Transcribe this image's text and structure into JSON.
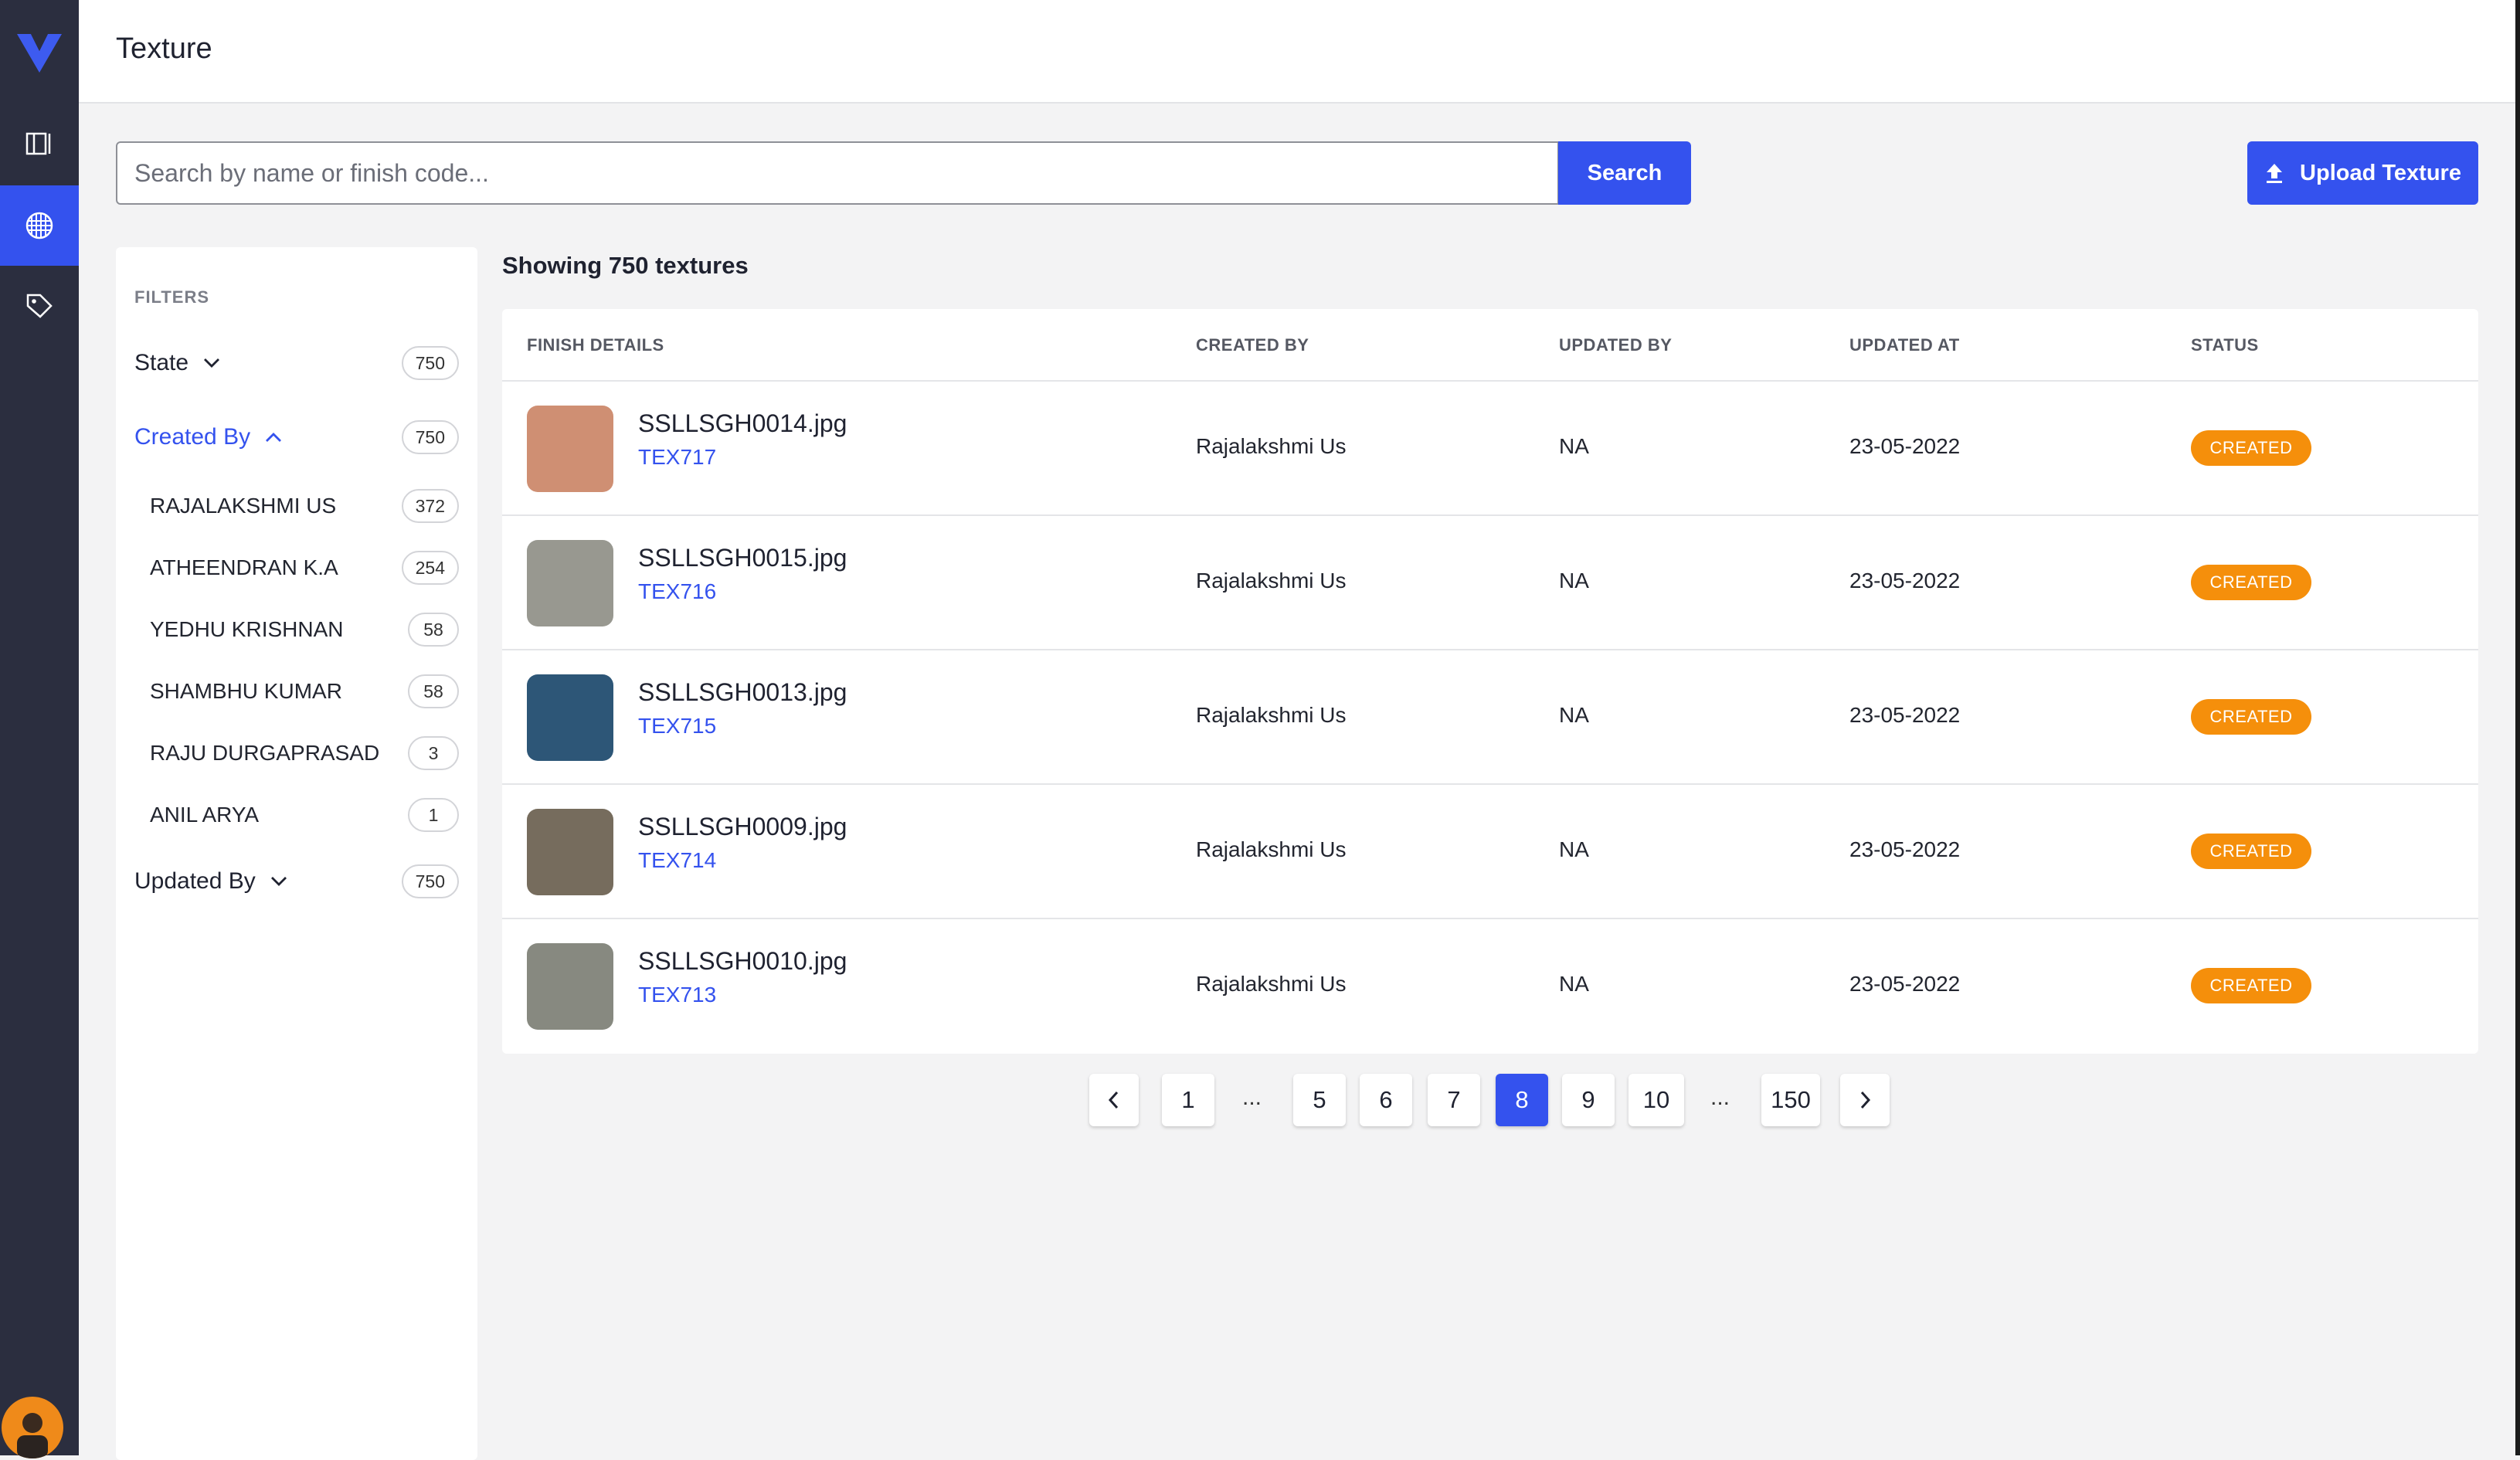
{
  "header": {
    "title": "Texture"
  },
  "search": {
    "placeholder": "Search by name or finish code...",
    "value": "",
    "button_label": "Search"
  },
  "upload": {
    "label": "Upload Texture"
  },
  "filters": {
    "title": "FILTERS",
    "groups": [
      {
        "label": "State",
        "count": "750",
        "expanded": false
      },
      {
        "label": "Created By",
        "count": "750",
        "expanded": true,
        "options": [
          {
            "label": "RAJALAKSHMI US",
            "count": "372"
          },
          {
            "label": "ATHEENDRAN K.A",
            "count": "254"
          },
          {
            "label": "YEDHU KRISHNAN",
            "count": "58"
          },
          {
            "label": "SHAMBHU KUMAR",
            "count": "58"
          },
          {
            "label": "RAJU DURGAPRASAD",
            "count": "3"
          },
          {
            "label": "ANIL ARYA",
            "count": "1"
          }
        ]
      },
      {
        "label": "Updated By",
        "count": "750",
        "expanded": false
      }
    ]
  },
  "list": {
    "showing": "Showing 750 textures",
    "columns": [
      "FINISH DETAILS",
      "CREATED BY",
      "UPDATED BY",
      "UPDATED AT",
      "STATUS"
    ],
    "rows": [
      {
        "file": "SSLLSGH0014.jpg",
        "code": "TEX717",
        "created_by": "Rajalakshmi Us",
        "updated_by": "NA",
        "updated_at": "23-05-2022",
        "status": "CREATED",
        "swatch": "#cf8f73"
      },
      {
        "file": "SSLLSGH0015.jpg",
        "code": "TEX716",
        "created_by": "Rajalakshmi Us",
        "updated_by": "NA",
        "updated_at": "23-05-2022",
        "status": "CREATED",
        "swatch": "#989890"
      },
      {
        "file": "SSLLSGH0013.jpg",
        "code": "TEX715",
        "created_by": "Rajalakshmi Us",
        "updated_by": "NA",
        "updated_at": "23-05-2022",
        "status": "CREATED",
        "swatch": "#2d5677"
      },
      {
        "file": "SSLLSGH0009.jpg",
        "code": "TEX714",
        "created_by": "Rajalakshmi Us",
        "updated_by": "NA",
        "updated_at": "23-05-2022",
        "status": "CREATED",
        "swatch": "#766c5d"
      },
      {
        "file": "SSLLSGH0010.jpg",
        "code": "TEX713",
        "created_by": "Rajalakshmi Us",
        "updated_by": "NA",
        "updated_at": "23-05-2022",
        "status": "CREATED",
        "swatch": "#878980"
      }
    ]
  },
  "pagination": {
    "pages": [
      "1",
      "5",
      "6",
      "7",
      "8",
      "9",
      "10",
      "150"
    ],
    "current": "8",
    "ellipsis": "..."
  },
  "colors": {
    "accent": "#3452ee",
    "rail": "#2b2e3f",
    "status_created": "#f58f0b"
  },
  "icons": {
    "logo": "brand-logo",
    "nav": [
      "book-icon",
      "texture-grid-icon",
      "tag-icon"
    ],
    "upload": "upload-icon",
    "prev": "chevron-left-icon",
    "next": "chevron-right-icon"
  }
}
